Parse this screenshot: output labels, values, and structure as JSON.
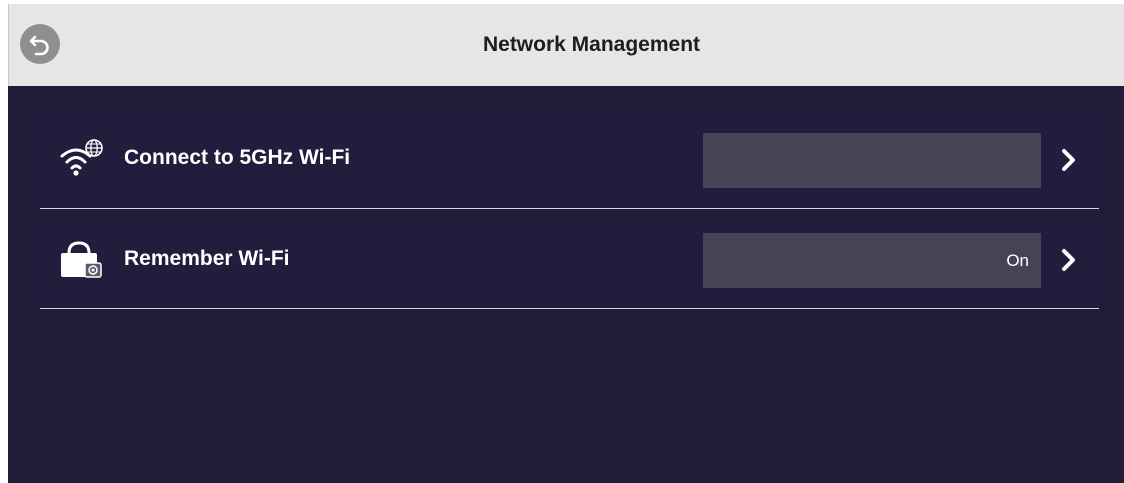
{
  "header": {
    "title": "Network Management",
    "back_icon": "back-arrow-icon"
  },
  "rows": [
    {
      "label": "Connect to 5GHz Wi-Fi",
      "value": "",
      "icon": "wifi-globe-icon"
    },
    {
      "label": "Remember Wi-Fi",
      "value": "On",
      "icon": "lock-bag-icon"
    }
  ],
  "colors": {
    "background": "#221b3a",
    "header_bg": "#e6e6e6",
    "value_box": "#474256",
    "divider": "#d6d6d6",
    "text": "#ffffff"
  }
}
